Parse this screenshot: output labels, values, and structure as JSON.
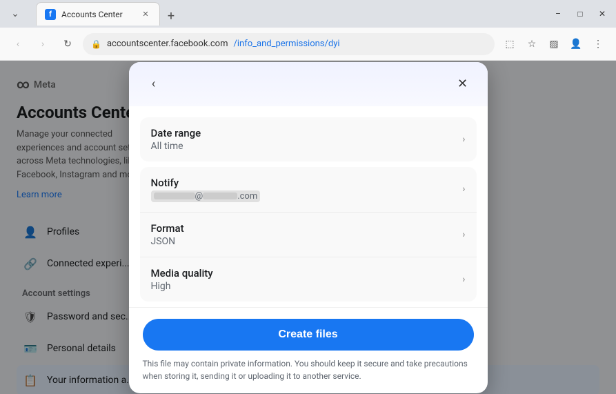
{
  "browser": {
    "tab": {
      "favicon_label": "f",
      "title": "Accounts Center",
      "close_label": "✕"
    },
    "new_tab_label": "+",
    "nav": {
      "back_label": "‹",
      "forward_label": "›",
      "refresh_label": "↻"
    },
    "url": {
      "icon": "🔒",
      "base": "accountscenter.facebook.com",
      "path": "/info_and_permissions/dyi"
    },
    "toolbar": {
      "cast_label": "⬚",
      "bookmark_label": "☆",
      "sidebar_label": "▨",
      "profile_label": "👤",
      "menu_label": "⋮"
    }
  },
  "sidebar": {
    "meta_logo": "∞",
    "meta_label": "Meta",
    "title": "Accounts Center",
    "description": "Manage your connected experiences and account settings across Meta technologies, like Facebook, Instagram and more.",
    "learn_more_label": "Learn more",
    "items": [
      {
        "id": "profiles",
        "icon": "👤",
        "label": "Profiles"
      },
      {
        "id": "connected",
        "icon": "🔗",
        "label": "Connected experi..."
      }
    ],
    "account_settings_header": "Account settings",
    "settings_items": [
      {
        "id": "password",
        "icon": "🛡",
        "label": "Password and sec..."
      },
      {
        "id": "personal",
        "icon": "🪪",
        "label": "Personal details"
      },
      {
        "id": "your-info",
        "icon": "📋",
        "label": "Your information a..."
      }
    ]
  },
  "modal": {
    "back_label": "‹",
    "close_label": "✕",
    "date_range": {
      "title": "Date range",
      "value": "All time"
    },
    "notify": {
      "title": "Notify",
      "value_masked": "████@██████.com",
      "value_suffix": ".com"
    },
    "format": {
      "title": "Format",
      "value": "JSON"
    },
    "media_quality": {
      "title": "Media quality",
      "value": "High"
    },
    "create_files_label": "Create files",
    "privacy_note": "This file may contain private information. You should keep it secure and take precautions when storing it, sending it or uploading it to another service."
  }
}
